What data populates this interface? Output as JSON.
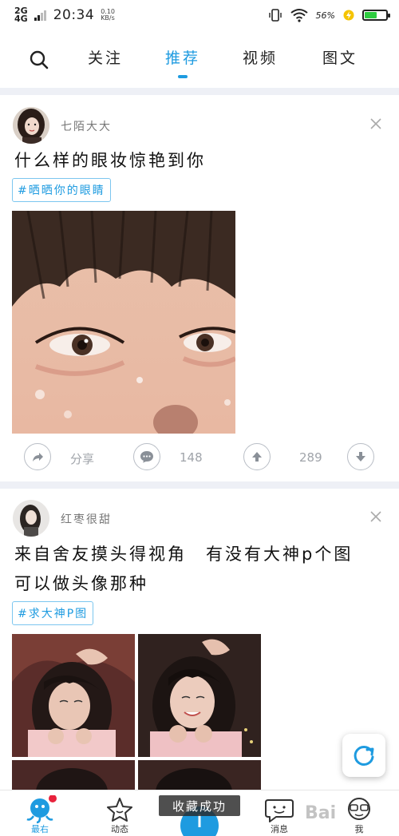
{
  "status_bar": {
    "network": "2G",
    "network2": "4G",
    "time": "20:34",
    "speed_value": "0.10",
    "speed_unit": "KB/s",
    "battery": "56%"
  },
  "nav": {
    "tabs": [
      {
        "label": "关注"
      },
      {
        "label": "推荐"
      },
      {
        "label": "视频"
      },
      {
        "label": "图文"
      }
    ],
    "active_index": 1
  },
  "posts": [
    {
      "author": "七陌大大",
      "title": "什么样的眼妆惊艳到你",
      "tag": "#晒晒你的眼睛",
      "share_label": "分享",
      "comments": "148",
      "likes": "289"
    },
    {
      "author": "红枣很甜",
      "title_line1": "来自舍友摸头得视角　有没有大神p个图",
      "title_line2": "可以做头像那种",
      "tag": "#求大神P图"
    }
  ],
  "bottom_tabs": [
    {
      "label": "最右"
    },
    {
      "label": "动态"
    },
    {
      "label": ""
    },
    {
      "label": "消息"
    },
    {
      "label": "我"
    }
  ],
  "toast": "收藏成功",
  "watermark": "Bai",
  "colors": {
    "accent": "#1e9be0",
    "divider": "#eef0f6",
    "badge": "#e8223c"
  }
}
